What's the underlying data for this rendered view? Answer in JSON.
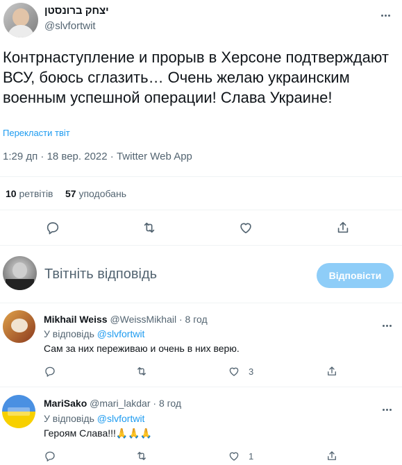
{
  "tweet": {
    "author_name": "יצחק ברונסטן",
    "author_handle": "@slvfortwit",
    "text": "Контрнаступление и прорыв в Херсоне подтверждают ВСУ, боюсь сглазить… Очень желаю украинским военным успешной операции! Слава Украине!",
    "translate_label": "Перекласти твіт",
    "meta": "1:29 дп · 18 вер. 2022 · Twitter Web App",
    "retweets_count": "10",
    "retweets_label": "ретвітів",
    "likes_count": "57",
    "likes_label": "уподобань"
  },
  "composer": {
    "placeholder": "Твітніть відповідь",
    "reply_button": "Відповісти"
  },
  "replies": [
    {
      "name": "Mikhail Weiss",
      "handle": "@WeissMikhail",
      "time": "· 8 год",
      "reply_to_label": "У відповідь",
      "reply_to_handle": "@slvfortwit",
      "text": "Сам за них переживаю и очень в них верю.",
      "like_count": "3"
    },
    {
      "name": "MariSako",
      "handle": "@mari_lakdar",
      "time": "· 8 год",
      "reply_to_label": "У відповідь",
      "reply_to_handle": "@slvfortwit",
      "text": "Героям Слава!!!🙏🙏🙏",
      "like_count": "1"
    }
  ],
  "colors": {
    "accent": "#1d9bf0",
    "muted": "#536471",
    "button_disabled": "#8ecdf8"
  }
}
